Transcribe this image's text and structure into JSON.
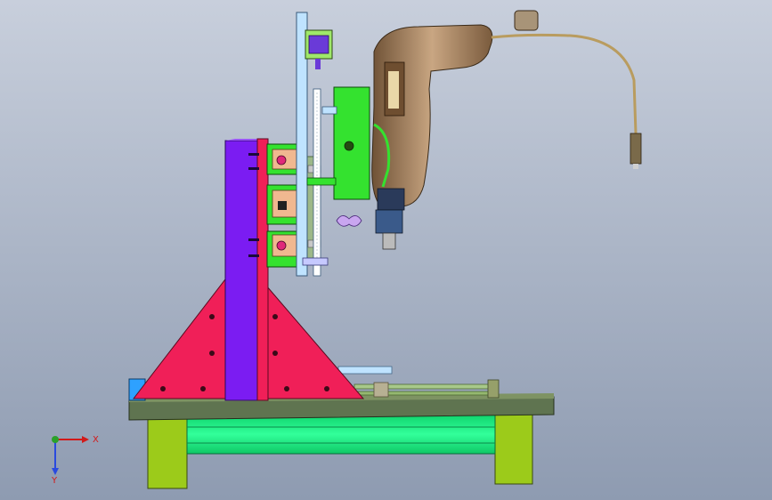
{
  "axes": {
    "x_label": "X",
    "y_label": "Y"
  },
  "colors": {
    "background_top": "#c8cfdc",
    "background_bottom": "#8e9bb1",
    "column": "#7b1cf2",
    "gusset": "#f01f58",
    "base_plate": "#5f7450",
    "legs": "#9ccb1a",
    "beam": "#16f07f",
    "drill_body": "#9a7b5a",
    "slide_block": "#34e22f",
    "mast": "#bfe3ff"
  },
  "icons": [
    "triad-icon"
  ]
}
